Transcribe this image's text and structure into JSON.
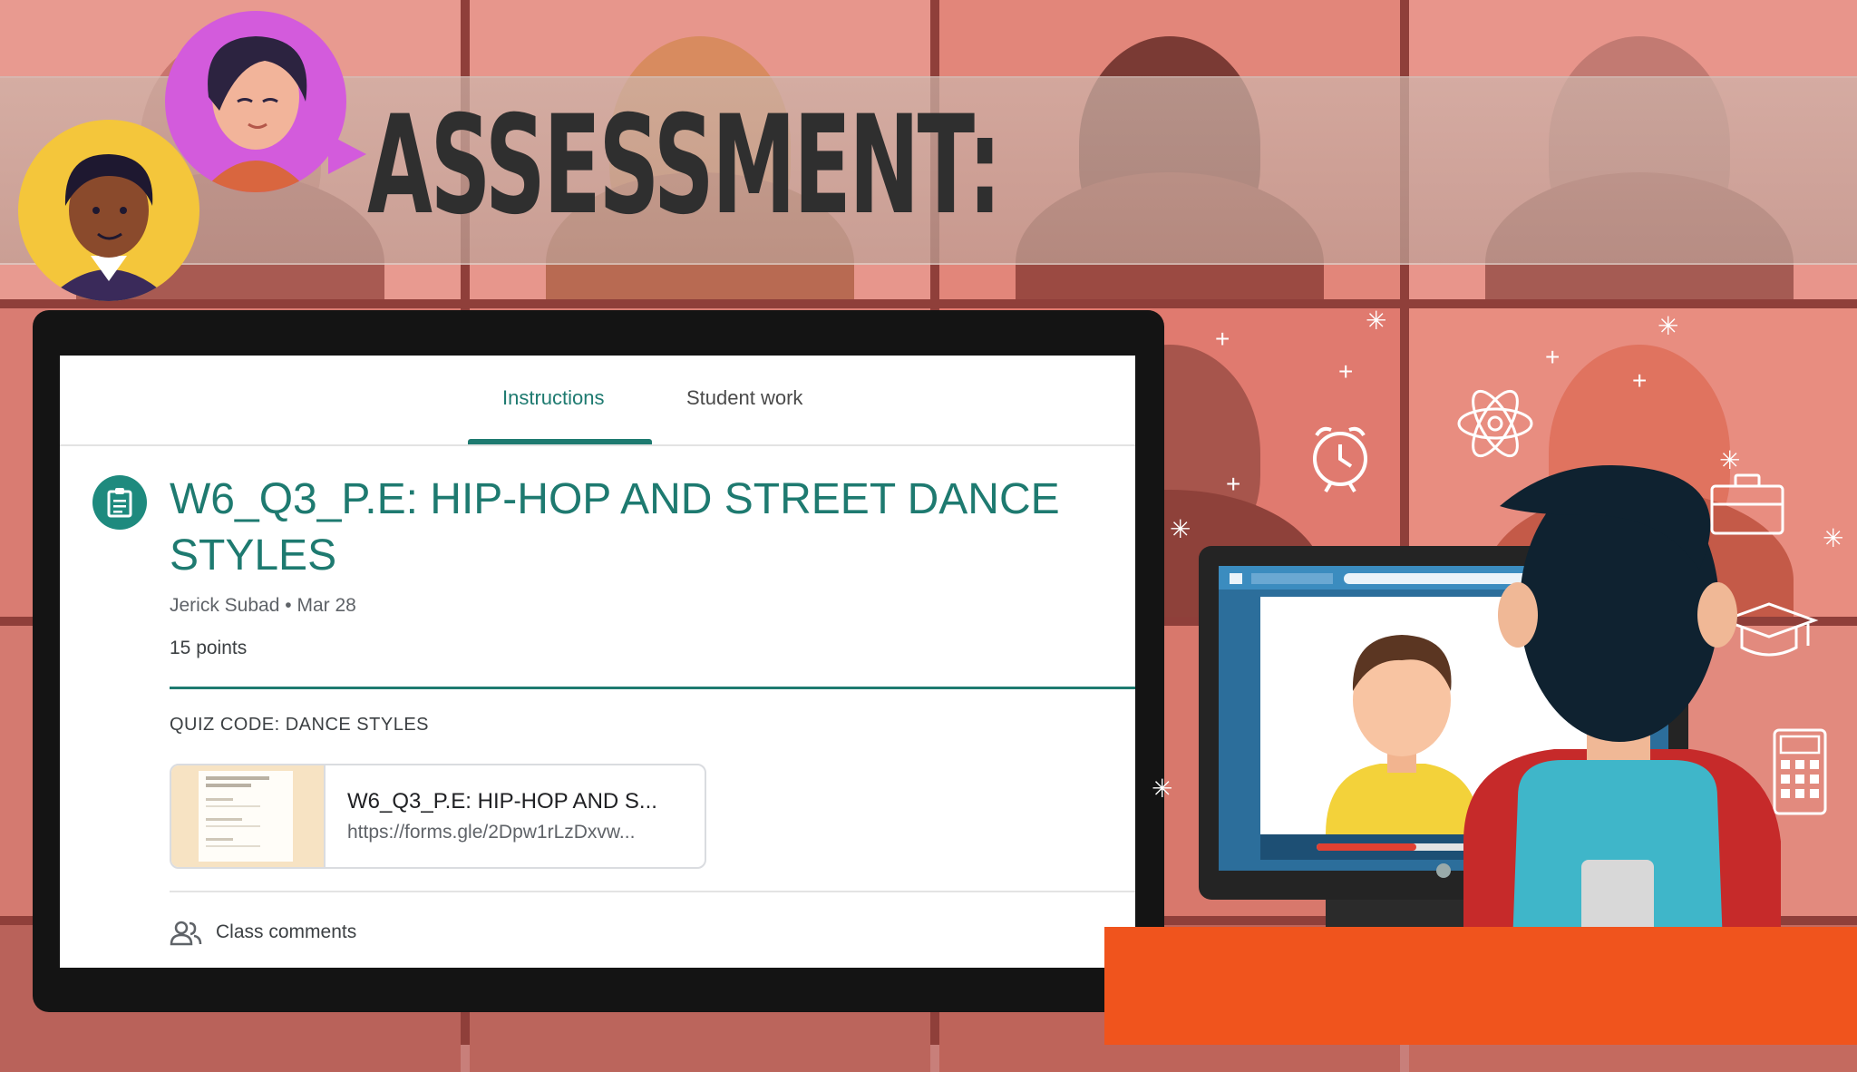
{
  "banner": {
    "title": "ASSESSMENT:"
  },
  "classroom": {
    "tabs": [
      {
        "label": "Instructions",
        "active": true
      },
      {
        "label": "Student work",
        "active": false
      }
    ],
    "assignment": {
      "icon": "assignment-icon",
      "title": "W6_Q3_P.E: HIP-HOP AND STREET DANCE STYLES",
      "author": "Jerick Subad",
      "separator": "•",
      "date": "Mar 28",
      "points": "15 points",
      "description": "QUIZ CODE: DANCE STYLES"
    },
    "attachment": {
      "title": "W6_Q3_P.E: HIP-HOP AND S...",
      "url": "https://forms.gle/2Dpw1rLzDxvw..."
    },
    "comments": {
      "icon": "people-icon",
      "label": "Class comments"
    }
  },
  "colors": {
    "accent": "#1e7a70",
    "background": "#c87f7a",
    "desk": "#f0541d"
  }
}
